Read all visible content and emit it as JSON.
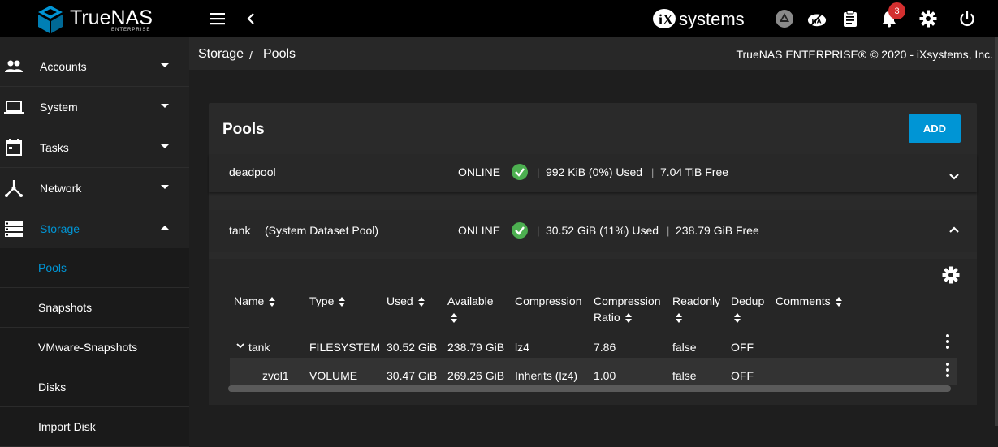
{
  "topbar": {
    "logo_text": "TrueNAS",
    "logo_sub": "ENTERPRISE",
    "vendor_logo": "systems",
    "notification_count": "3",
    "icons": [
      "menu-icon",
      "back-chevron-icon",
      "truecommand-icon",
      "ha-disabled-icon",
      "clipboard-icon",
      "bell-icon",
      "gear-icon",
      "power-icon"
    ]
  },
  "sidebar": {
    "items": [
      {
        "label": "Accounts",
        "icon": "people-icon"
      },
      {
        "label": "System",
        "icon": "laptop-icon"
      },
      {
        "label": "Tasks",
        "icon": "calendar-icon"
      },
      {
        "label": "Network",
        "icon": "network-icon"
      },
      {
        "label": "Storage",
        "icon": "storage-icon"
      }
    ],
    "subitems": [
      {
        "label": "Pools"
      },
      {
        "label": "Snapshots"
      },
      {
        "label": "VMware-Snapshots"
      },
      {
        "label": "Disks"
      },
      {
        "label": "Import Disk"
      }
    ],
    "active_color": "#0095d5"
  },
  "breadcrumb": {
    "parent": "Storage",
    "separator": "/",
    "current": "Pools",
    "copyright": "TrueNAS ENTERPRISE® © 2020 - iXsystems, Inc."
  },
  "card": {
    "title": "Pools",
    "add_label": "ADD"
  },
  "pools": [
    {
      "name": "deadpool",
      "status": "ONLINE",
      "used": "992 KiB (0%) Used",
      "free": "7.04 TiB Free",
      "sep": "|"
    },
    {
      "name": "tank",
      "note": "(System Dataset Pool)",
      "status": "ONLINE",
      "used": "30.52 GiB (11%) Used",
      "free": "238.79 GiB Free",
      "sep": "|"
    }
  ],
  "table": {
    "headers": {
      "name": "Name",
      "type": "Type",
      "used": "Used",
      "available": "Available",
      "compression": "Compression",
      "ratio_1": "Compression",
      "ratio_2": "Ratio",
      "readonly": "Readonly",
      "dedup": "Dedup",
      "comments": "Comments"
    },
    "rows": [
      {
        "name": "tank",
        "type": "FILESYSTEM",
        "used": "30.52 GiB",
        "available": "238.79 GiB",
        "compression": "lz4",
        "ratio": "7.86",
        "readonly": "false",
        "dedup": "OFF",
        "comments": ""
      },
      {
        "name": "zvol1",
        "type": "VOLUME",
        "used": "30.47 GiB",
        "available": "269.26 GiB",
        "compression": "Inherits (lz4)",
        "ratio": "1.00",
        "readonly": "false",
        "dedup": "OFF",
        "comments": ""
      }
    ]
  },
  "colors": {
    "accent": "#0095d5",
    "online": "#4caf50",
    "badge": "#d32f2f"
  }
}
